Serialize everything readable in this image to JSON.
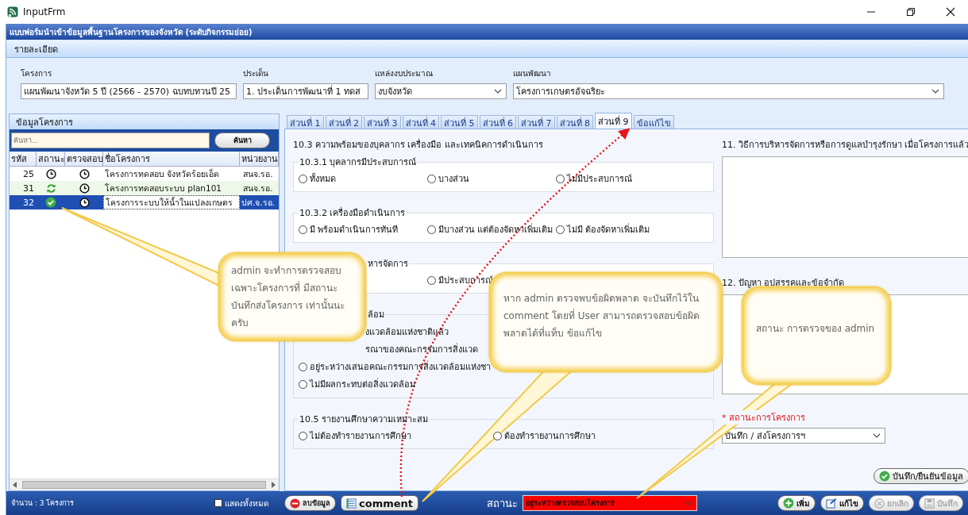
{
  "window": {
    "title": "InputFrm"
  },
  "form_header": "แบบฟอร์มนำเข้าข้อมูลพื้นฐานโครงการของจังหวัด (ระดับกิจกรรมย่อย)",
  "details_section": {
    "title": "รายละเอียด",
    "filters": [
      {
        "label": "โครงการ",
        "value": "แผนพัฒนาจังหวัด 5 ปี (2566 - 2570) ฉบทบทวนปี 25"
      },
      {
        "label": "ประเด็น",
        "value": "1. ประเด็นการพัฒนาที่ 1 ทดส"
      },
      {
        "label": "แหล่งงบประมาณ",
        "value": "งบจังหวัด"
      },
      {
        "label": "แผนพัฒนา",
        "value": "โครงการเกษตรอัจฉริยะ"
      }
    ]
  },
  "project_panel": {
    "title": "ข้อมูลโครงการ",
    "search": {
      "placeholder": "ค้นหา...",
      "button": "ค้นหา"
    },
    "columns": [
      "รหัส",
      "สถานะ",
      "ตรวจสอบ",
      "ชื่อโครงการ",
      "หน่วยงาน"
    ],
    "rows": [
      {
        "code": "25",
        "status": {
          "kind": "pending"
        },
        "review": {
          "kind": "pending"
        },
        "name": "โครงการทดสอบ จังหวัดร้อยเอ็ด",
        "unit": "สนจ.รอ.",
        "selected": false
      },
      {
        "code": "31",
        "status": {
          "kind": "sent"
        },
        "review": {
          "kind": "pending"
        },
        "name": "โครงการทดสอบระบบ plan101",
        "unit": "สนจ.รอ.",
        "selected": false
      },
      {
        "code": "32",
        "status": {
          "kind": "done"
        },
        "review": {
          "kind": "pending"
        },
        "name": "โครงการระบบให้น้ำในแปลงเกษตร",
        "unit": "ปศ.จ.รอ.",
        "selected": true
      }
    ],
    "count": "จำนวน : 3 โครงการ",
    "show_all": {
      "label": "แสดงทั้งหมด",
      "checked": false
    }
  },
  "tabs": [
    {
      "label": "ส่วนที่ 1",
      "selected": false
    },
    {
      "label": "ส่วนที่ 2",
      "selected": false
    },
    {
      "label": "ส่วนที่ 3",
      "selected": false
    },
    {
      "label": "ส่วนที่ 4",
      "selected": false
    },
    {
      "label": "ส่วนที่ 5",
      "selected": false
    },
    {
      "label": "ส่วนที่ 6",
      "selected": false
    },
    {
      "label": "ส่วนที่ 7",
      "selected": false
    },
    {
      "label": "ส่วนที่ 8",
      "selected": false
    },
    {
      "label": "ส่วนที่ 9",
      "selected": true
    },
    {
      "label": "ข้อแก้ไข",
      "selected": false
    }
  ],
  "form": {
    "heading": "10.3 ความพร้อมของบุคลากร เครื่องมือ และเทคนิคการดำเนินการ",
    "groups": [
      {
        "kind": "row",
        "legend": "10.3.1 บุคลากรมีประสบการณ์",
        "options": [
          {
            "kind": "radio",
            "label": "ทั้งหมด",
            "selected": false
          },
          {
            "kind": "radio",
            "label": "บางส่วน",
            "selected": false
          },
          {
            "kind": "radio",
            "label": "ไม่มีประสบการณ์",
            "selected": false
          }
        ]
      },
      {
        "kind": "row",
        "legend": "10.3.2 เครื่องมือดำเนินการ",
        "options": [
          {
            "kind": "radio",
            "label": "มี พร้อมดำเนินการทันที",
            "selected": false
          },
          {
            "kind": "radio",
            "label": "มีบางส่วน แต่ต้องจัดหาเพิ่มเติม",
            "selected": false
          },
          {
            "kind": "radio",
            "label": "ไม่มี ต้องจัดหาเพิ่มเติม",
            "selected": false
          }
        ]
      },
      {
        "kind": "covered_row",
        "legend": "หารจัดการ",
        "options": [
          {
            "kind": "radio",
            "label": "มีประสบการณ์",
            "selected": false
          }
        ]
      },
      {
        "kind": "covered_column",
        "legend": "ล้อม",
        "options": [
          {
            "kind": "fragment",
            "label": "งแวดล้อมแห่งชาติแล้ว"
          },
          {
            "kind": "fragment",
            "label": "รณาของคณะกรรมการสิ่งแวด"
          },
          {
            "kind": "radio",
            "label": "อยู่ระหว่างเสนอคณะกรรมการสิ่งแวดล้อมแห่งชา",
            "selected": false
          },
          {
            "kind": "radio",
            "label": "ไม่มีผลกระทบต่อสิ่งแวดล้อม",
            "selected": false
          }
        ]
      },
      {
        "kind": "wide",
        "legend": "10.5 รายงานศึกษาความเหมาะสม",
        "options": [
          {
            "kind": "radio",
            "label": "ไม่ต้องทำรายงานการศึกษา",
            "selected": false
          },
          {
            "kind": "radio",
            "label": "ต้องทำรายงานการศึกษา",
            "selected": false
          }
        ]
      }
    ]
  },
  "right_fields": {
    "q11": "11. วิธีการบริหารจัดการหรือการดูแลบำรุงรักษา เมื่อโครงการแล้ว",
    "q12": "12. ปัญหา อุปสรรคและข้อจำกัด",
    "status_label": "* สถานะการโครงการ",
    "status_value": "บันทึก / ส่งโครงการฯ",
    "confirm_button": "บันทึก/ยืนยันข้อมูล"
  },
  "bottom_bar": {
    "left_buttons": [
      {
        "kind": "delete",
        "label": "ลบข้อมูล"
      },
      {
        "kind": "comment",
        "label": "comment"
      }
    ],
    "status_label": "สถานะ",
    "status_value": "อยู่ระหว่างตรวจสอบโครงการ",
    "actions": [
      {
        "kind": "add",
        "label": "เพิ่ม",
        "disabled": false
      },
      {
        "kind": "edit",
        "label": "แก้ไข",
        "disabled": false
      },
      {
        "kind": "cancel",
        "label": "ยกเลิก",
        "disabled": true
      },
      {
        "kind": "save",
        "label": "บันทึก",
        "disabled": true
      }
    ]
  },
  "annotations": [
    {
      "text": "admin จะทำการตรวจสอบ เฉพาะโครงการที่ มีสถานะ บันทึกส่งโครงการ เท่านั้นนะ ครับ"
    },
    {
      "text": "หาก admin ตรวจพบข้อผิดพลาด จะบันทึกไว้ใน comment โดยที่ User สามารถตรวจสอบข้อผิดพลาดได้ที่แท็บ ข้อแก้ไข"
    },
    {
      "text": "สถานะ การตรวจของ admin"
    }
  ]
}
